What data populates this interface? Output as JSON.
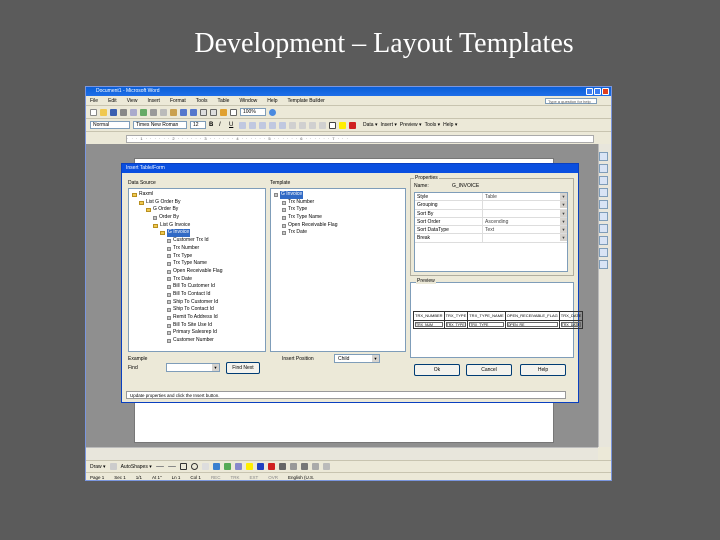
{
  "slide": {
    "title": "Development – Layout Templates"
  },
  "window": {
    "title": "Document1 - Microsoft Word"
  },
  "menu": [
    "File",
    "Edit",
    "View",
    "Insert",
    "Format",
    "Tools",
    "Table",
    "Window",
    "Help",
    "Template Builder"
  ],
  "ask_placeholder": "Type a question for help",
  "toolbar": {
    "zoom": "100%",
    "style": "Normal",
    "font": "Times New Roman",
    "size": "12",
    "right_items": [
      "Data ▾",
      "Insert ▾",
      "Preview ▾",
      "Tools ▾",
      "Help ▾"
    ]
  },
  "ruler_text": "· · · 1 · · · · · · 2 · · · · · · 3 · · · · · · 4 · · · · · · 5 · · · · · · 6 · · · · · · 7 · · ·",
  "dialog": {
    "title": "Insert Table/Form",
    "data_source_label": "Data Source",
    "template_label": "Template",
    "properties_label": "Properties",
    "preview_label": "Preview",
    "name_label": "Name:",
    "name_value": "G_INVOICE",
    "example_label": "Example",
    "find_label": "Find",
    "find_next": "Find Next",
    "insert_position_label": "Insert Position",
    "insert_position_value": "Child",
    "ok": "Ok",
    "cancel": "Cancel",
    "help": "Help",
    "status": "Update properties and click the Insert button.",
    "tree": [
      {
        "label": "Raxml",
        "indent": 0,
        "type": "folder"
      },
      {
        "label": "List G Order By",
        "indent": 1,
        "type": "folder"
      },
      {
        "label": "G Order By",
        "indent": 2,
        "type": "folder"
      },
      {
        "label": "Order By",
        "indent": 3,
        "type": "field"
      },
      {
        "label": "List G Invoice",
        "indent": 3,
        "type": "folder"
      },
      {
        "label": "G Invoice",
        "indent": 4,
        "type": "folder",
        "selected": true
      },
      {
        "label": "Customer Trx Id",
        "indent": 5,
        "type": "field"
      },
      {
        "label": "Trx Number",
        "indent": 5,
        "type": "field"
      },
      {
        "label": "Trx Type",
        "indent": 5,
        "type": "field"
      },
      {
        "label": "Trx Type Name",
        "indent": 5,
        "type": "field"
      },
      {
        "label": "Open Receivable Flag",
        "indent": 5,
        "type": "field"
      },
      {
        "label": "Trx Date",
        "indent": 5,
        "type": "field"
      },
      {
        "label": "Bill To Customer Id",
        "indent": 5,
        "type": "field"
      },
      {
        "label": "Bill To Contact Id",
        "indent": 5,
        "type": "field"
      },
      {
        "label": "Ship To Customer Id",
        "indent": 5,
        "type": "field"
      },
      {
        "label": "Ship To Contact Id",
        "indent": 5,
        "type": "field"
      },
      {
        "label": "Remit To Address Id",
        "indent": 5,
        "type": "field"
      },
      {
        "label": "Bill To Site Use Id",
        "indent": 5,
        "type": "field"
      },
      {
        "label": "Primary Salesrep Id",
        "indent": 5,
        "type": "field"
      },
      {
        "label": "Customer Number",
        "indent": 5,
        "type": "field"
      }
    ],
    "template_tree": [
      {
        "label": "G Invoice",
        "indent": 0,
        "selected": true
      },
      {
        "label": "Trx Number",
        "indent": 1
      },
      {
        "label": "Trx Type",
        "indent": 1
      },
      {
        "label": "Trx Type Name",
        "indent": 1
      },
      {
        "label": "Open Receivable Flag",
        "indent": 1
      },
      {
        "label": "Trx Date",
        "indent": 1
      }
    ],
    "properties": [
      {
        "key": "Style",
        "value": "Table",
        "dropdown": true
      },
      {
        "key": "Grouping",
        "value": "",
        "dropdown": true
      },
      {
        "key": "Sort By",
        "value": "",
        "dropdown": true
      },
      {
        "key": "Sort Order",
        "value": "Ascending",
        "dropdown": true
      },
      {
        "key": "Sort DataType",
        "value": "Text",
        "dropdown": true
      },
      {
        "key": "Break",
        "value": "",
        "dropdown": true
      }
    ],
    "preview": {
      "headers": [
        "TRX_NUMBER",
        "TRX_TYPE",
        "TRX_TYPE_NAME",
        "OPEN_RECEIVABLE_FLAG",
        "TRX_DATE"
      ],
      "cells": [
        "TRX_NUM",
        "TRX_TYPE",
        "TRX_TYPE",
        "OPEN_RE",
        "TRX_DATE"
      ]
    }
  },
  "drawbar": {
    "draw": "Draw ▾",
    "autoshapes": "AutoShapes ▾"
  },
  "statusbar": [
    "Page 1",
    "Sec 1",
    "1/1",
    "At 1\"",
    "Ln 1",
    "Col 1",
    "REC",
    "TRK",
    "EXT",
    "OVR",
    "English (U.S."
  ]
}
